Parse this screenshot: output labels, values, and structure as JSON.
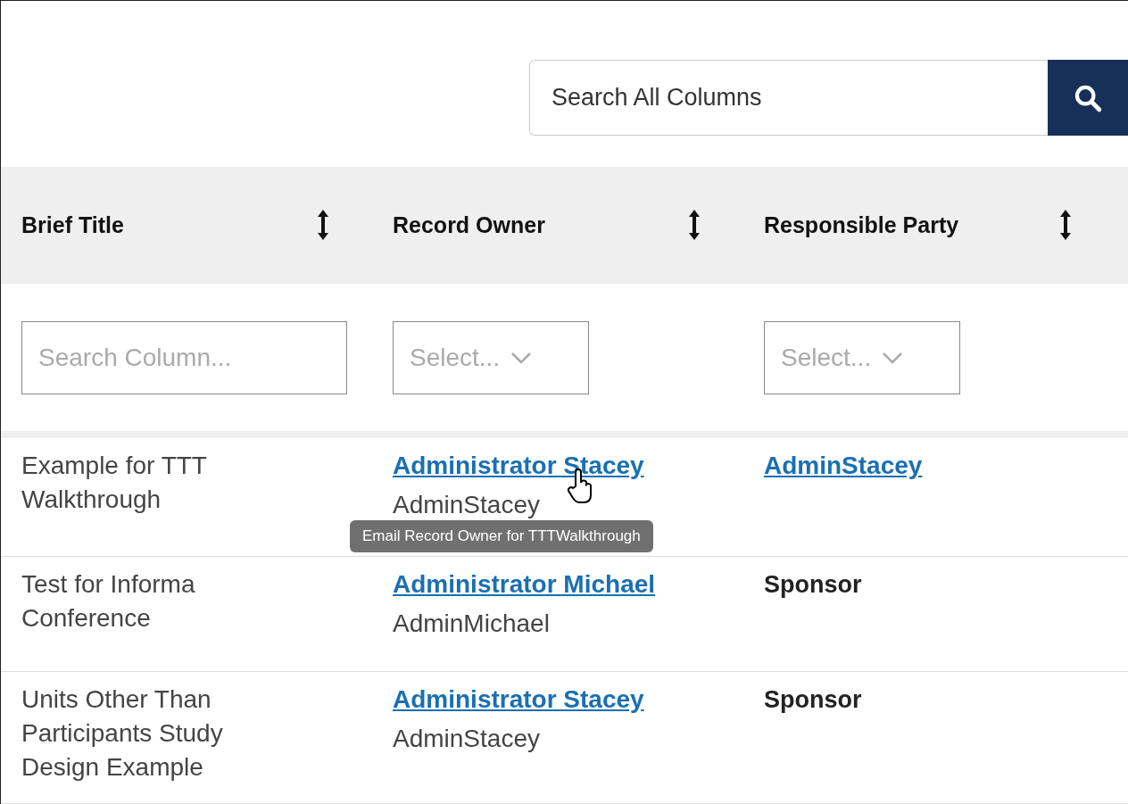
{
  "search": {
    "placeholder": "Search All Columns"
  },
  "columns": [
    {
      "label": "Brief Title",
      "filter": {
        "kind": "text",
        "placeholder": "Search Column..."
      }
    },
    {
      "label": "Record Owner",
      "filter": {
        "kind": "select",
        "placeholder": "Select..."
      }
    },
    {
      "label": "Responsible Party",
      "filter": {
        "kind": "select",
        "placeholder": "Select..."
      }
    }
  ],
  "rows": [
    {
      "brief_title": "Example for TTT Walkthrough",
      "owner": {
        "name": "Administrator Stacey",
        "username": "AdminStacey"
      },
      "responsible": {
        "kind": "link",
        "text": "AdminStacey"
      },
      "tooltip": "Email Record Owner for TTTWalkthrough"
    },
    {
      "brief_title": "Test for Informa Conference",
      "owner": {
        "name": "Administrator Michael",
        "username": "AdminMichael"
      },
      "responsible": {
        "kind": "text",
        "text": "Sponsor"
      }
    },
    {
      "brief_title": "Units Other Than Participants Study Design Example",
      "owner": {
        "name": "Administrator Stacey",
        "username": "AdminStacey"
      },
      "responsible": {
        "kind": "text",
        "text": "Sponsor"
      }
    }
  ]
}
